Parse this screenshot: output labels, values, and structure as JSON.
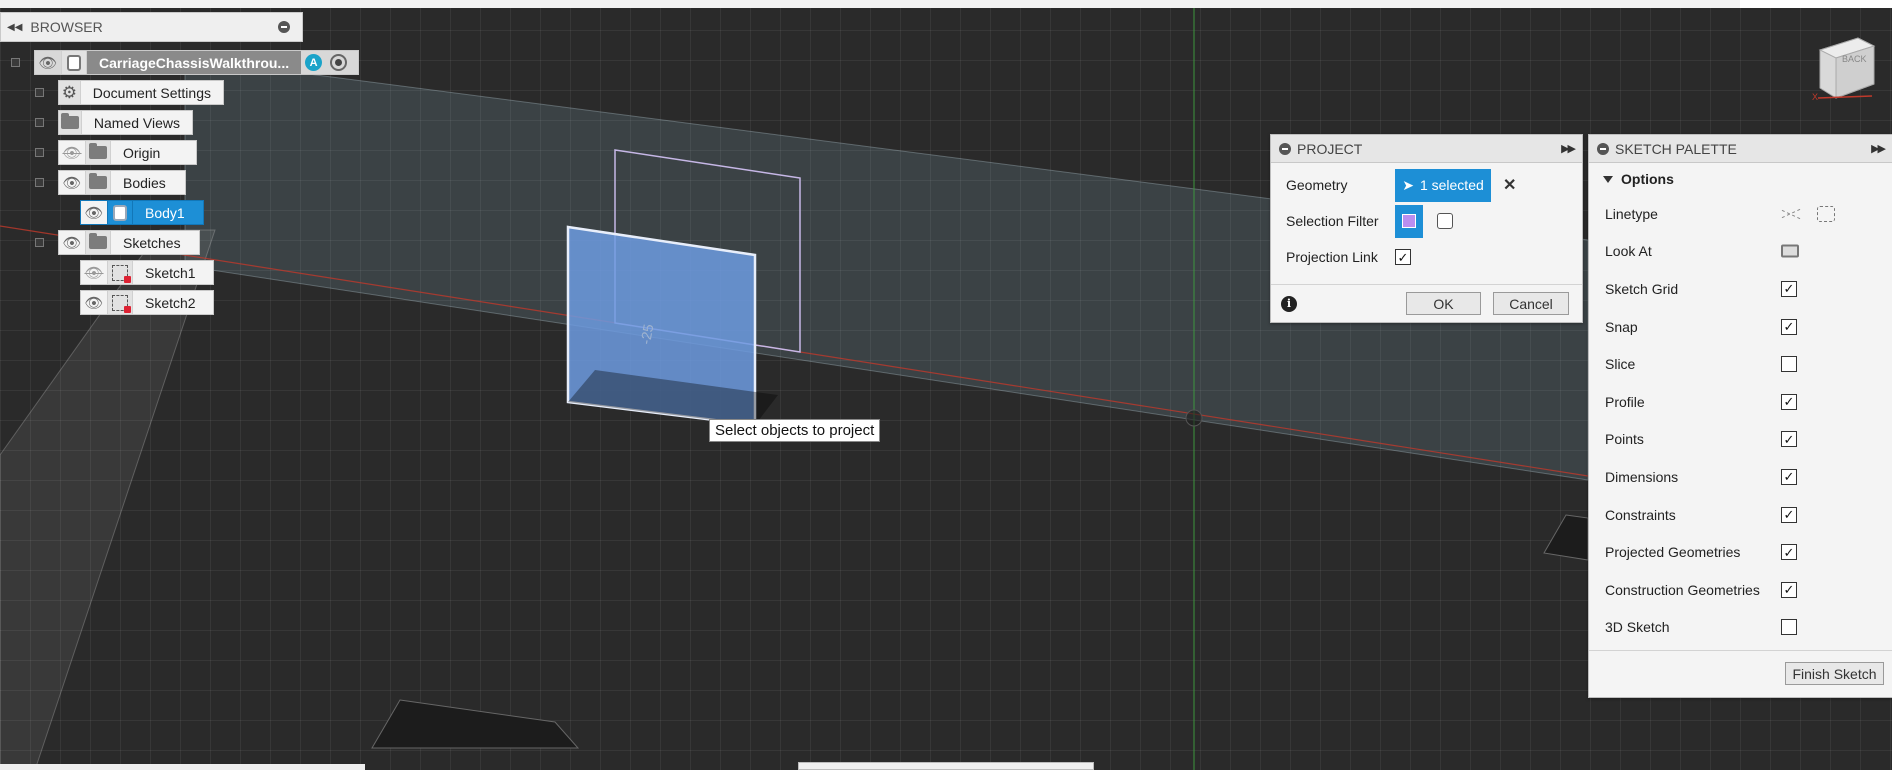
{
  "browser": {
    "title": "BROWSER",
    "root": {
      "label": "CarriageChassisWalkthrou...",
      "badge": "A"
    },
    "items": [
      {
        "label": "Document Settings"
      },
      {
        "label": "Named Views"
      },
      {
        "label": "Origin"
      },
      {
        "label": "Bodies"
      },
      {
        "label": "Body1"
      },
      {
        "label": "Sketches"
      },
      {
        "label": "Sketch1"
      },
      {
        "label": "Sketch2"
      }
    ]
  },
  "viewport": {
    "tooltip": "Select objects to project",
    "dimension_label": "-25"
  },
  "project": {
    "title": "PROJECT",
    "geometry_label": "Geometry",
    "geometry_value": "1 selected",
    "selection_filter_label": "Selection Filter",
    "projection_link_label": "Projection Link",
    "projection_link_checked": true,
    "ok_label": "OK",
    "cancel_label": "Cancel"
  },
  "sketch_palette": {
    "title": "SKETCH PALETTE",
    "section": "Options",
    "options": [
      {
        "label": "Linetype",
        "control": "icons"
      },
      {
        "label": "Look At",
        "control": "icon"
      },
      {
        "label": "Sketch Grid",
        "checked": true
      },
      {
        "label": "Snap",
        "checked": true
      },
      {
        "label": "Slice",
        "checked": false
      },
      {
        "label": "Profile",
        "checked": true
      },
      {
        "label": "Points",
        "checked": true
      },
      {
        "label": "Dimensions",
        "checked": true
      },
      {
        "label": "Constraints",
        "checked": true
      },
      {
        "label": "Projected Geometries",
        "checked": true
      },
      {
        "label": "Construction Geometries",
        "checked": true
      },
      {
        "label": "3D Sketch",
        "checked": false
      }
    ],
    "finish_label": "Finish Sketch"
  },
  "viewcube": {
    "face_label": "BACK"
  },
  "colors": {
    "accent": "#1d8fd6",
    "selection_face": "#6d9be0",
    "axis_red": "#c0392b",
    "axis_green": "#3f9a3f"
  }
}
